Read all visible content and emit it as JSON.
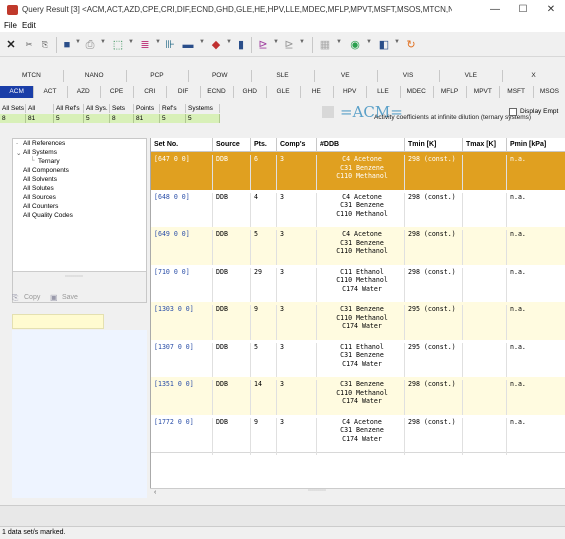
{
  "window": {
    "title": "Query Result [3] <ACM,ACT,AZD,CPE,CRI,DIF,ECND,GHD,GLE,HE,HPV,LLE,MDEC,MFLP,MPVT,MSFT,MSOS,MTCN,NAN...",
    "minimize": "—",
    "maximize": "☐",
    "close": "✕"
  },
  "menu": {
    "file": "File",
    "edit": "Edit"
  },
  "toolbar_icons": [
    "close-x-icon",
    "cut-icon",
    "paste-icon",
    "save-icon",
    "print-icon",
    "export-icon",
    "filter-icon",
    "chart-icon",
    "table-icon",
    "mixture-icon",
    "book-icon",
    "edit-chart-icon",
    "edit-chart2-icon",
    "grid-icon",
    "help-icon",
    "window-icon",
    "refresh-icon"
  ],
  "tabs_top": [
    "MTCN",
    "NANO",
    "PCP",
    "POW",
    "SLE",
    "VE",
    "VIS",
    "VLE",
    "X"
  ],
  "tabs_bottom": [
    "ACM",
    "ACT",
    "AZD",
    "CPE",
    "CRI",
    "DIF",
    "ECND",
    "GHD",
    "GLE",
    "HE",
    "HPV",
    "LLE",
    "MDEC",
    "MFLP",
    "MPVT",
    "MSFT",
    "MSOS"
  ],
  "active_tab": "ACM",
  "counts": {
    "headers": [
      "All Sets",
      "All Points",
      "All Ref's",
      "All Sys.",
      "Sets",
      "Points",
      "Ref's",
      "Systems"
    ],
    "values": [
      "8",
      "81",
      "5",
      "5",
      "8",
      "81",
      "5",
      "5"
    ]
  },
  "acm": {
    "logo": "=ACM=",
    "description": "Activity coefficients at infinite dilution (ternary systems)"
  },
  "display_empty": "Display Empt",
  "tree": {
    "items": [
      "All References",
      "All Systems",
      "Ternary",
      "All Components",
      "All Solvents",
      "All Solutes",
      "All Sources",
      "All Counters",
      "All Quality Codes"
    ]
  },
  "left_buttons": {
    "copy": "Copy",
    "save": "Save"
  },
  "grid": {
    "columns": [
      "Set No.",
      "Source",
      "Pts.",
      "Comp's",
      "#DDB",
      "Tmin [K]",
      "Tmax [K]",
      "Pmin [kPa]"
    ],
    "rows": [
      {
        "set": "[647 0 0]",
        "source": "DDB",
        "pts": "6",
        "comps": "3",
        "ddb": [
          "C4 Acetone",
          "C31 Benzene",
          "C110 Methanol"
        ],
        "tmin": "298 (const.)",
        "tmax": "",
        "pmin": "n.a."
      },
      {
        "set": "[648 0 0]",
        "source": "DDB",
        "pts": "4",
        "comps": "3",
        "ddb": [
          "C4 Acetone",
          "C31 Benzene",
          "C110 Methanol"
        ],
        "tmin": "298 (const.)",
        "tmax": "",
        "pmin": "n.a."
      },
      {
        "set": "[649 0 0]",
        "source": "DDB",
        "pts": "5",
        "comps": "3",
        "ddb": [
          "C4 Acetone",
          "C31 Benzene",
          "C110 Methanol"
        ],
        "tmin": "298 (const.)",
        "tmax": "",
        "pmin": "n.a."
      },
      {
        "set": "[710 0 0]",
        "source": "DDB",
        "pts": "29",
        "comps": "3",
        "ddb": [
          "C11 Ethanol",
          "C110 Methanol",
          "C174 Water"
        ],
        "tmin": "298 (const.)",
        "tmax": "",
        "pmin": "n.a."
      },
      {
        "set": "[1303 0 0]",
        "source": "DDB",
        "pts": "9",
        "comps": "3",
        "ddb": [
          "C31 Benzene",
          "C110 Methanol",
          "C174 Water"
        ],
        "tmin": "295 (const.)",
        "tmax": "",
        "pmin": "n.a."
      },
      {
        "set": "[1307 0 0]",
        "source": "DDB",
        "pts": "5",
        "comps": "3",
        "ddb": [
          "C11 Ethanol",
          "C31 Benzene",
          "C174 Water"
        ],
        "tmin": "295 (const.)",
        "tmax": "",
        "pmin": "n.a."
      },
      {
        "set": "[1351 0 0]",
        "source": "DDB",
        "pts": "14",
        "comps": "3",
        "ddb": [
          "C31 Benzene",
          "C110 Methanol",
          "C174 Water"
        ],
        "tmin": "298 (const.)",
        "tmax": "",
        "pmin": "n.a."
      },
      {
        "set": "[1772 0 0]",
        "source": "DDB",
        "pts": "9",
        "comps": "3",
        "ddb": [
          "C4 Acetone",
          "C31 Benzene",
          "C174 Water"
        ],
        "tmin": "298 (const.)",
        "tmax": "",
        "pmin": "n.a."
      }
    ]
  },
  "status": "1 data set/s marked.",
  "colors": {
    "accent": "#1a3ea8",
    "selected_row": "#e0a020",
    "alt_row": "#fffbe0",
    "count_bg": "#d8f0b8"
  }
}
